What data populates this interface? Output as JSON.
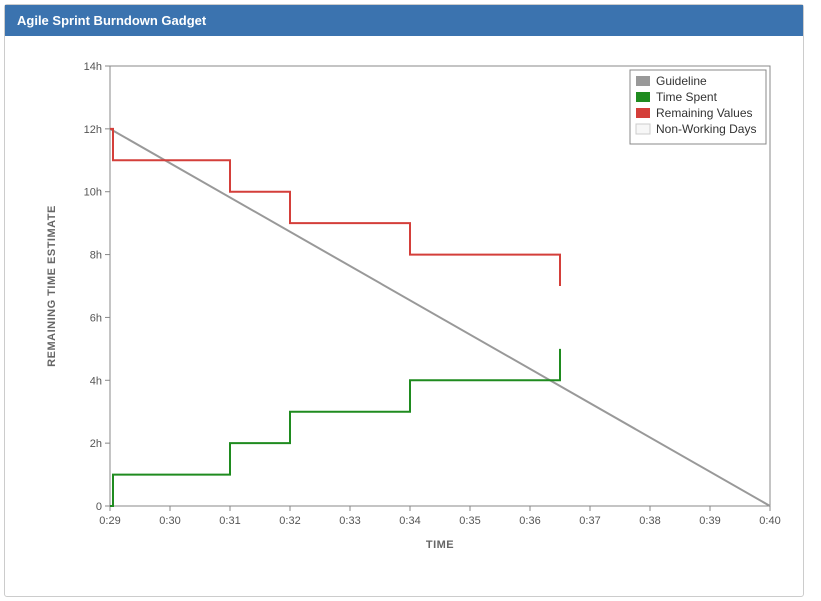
{
  "header": {
    "title": "Agile Sprint Burndown Gadget"
  },
  "chart_data": {
    "type": "line",
    "title": "",
    "xlabel": "TIME",
    "ylabel": "REMAINING TIME ESTIMATE",
    "xlim": [
      29,
      40
    ],
    "ylim": [
      0,
      14
    ],
    "x_tick_prefix": "0:",
    "y_tick_suffix": "h",
    "x_ticks": [
      29,
      30,
      31,
      32,
      33,
      34,
      35,
      36,
      37,
      38,
      39,
      40
    ],
    "y_ticks": [
      0,
      2,
      4,
      6,
      8,
      10,
      12,
      14
    ],
    "legend": {
      "position": "top-right",
      "items": [
        {
          "name": "Guideline",
          "color": "#999999",
          "type": "line"
        },
        {
          "name": "Time Spent",
          "color": "#1f8b1f",
          "type": "line"
        },
        {
          "name": "Remaining Values",
          "color": "#d43f3a",
          "type": "line"
        },
        {
          "name": "Non-Working Days",
          "color": "#f7f7f7",
          "type": "area",
          "border": "#cccccc"
        }
      ]
    },
    "series": [
      {
        "name": "Guideline",
        "color": "#999999",
        "mode": "line",
        "x": [
          29,
          40
        ],
        "y": [
          12,
          0
        ]
      },
      {
        "name": "Time Spent",
        "color": "#1f8b1f",
        "mode": "step",
        "x": [
          29.0,
          29.05,
          31.0,
          32.0,
          34.0,
          36.0,
          36.5
        ],
        "y": [
          0,
          1,
          2,
          3,
          4,
          4,
          5
        ],
        "end_x": 36.5
      },
      {
        "name": "Remaining Values",
        "color": "#d43f3a",
        "mode": "step",
        "x": [
          29.0,
          29.05,
          31.0,
          32.0,
          34.0,
          36.0,
          36.5
        ],
        "y": [
          12,
          11,
          10,
          9,
          8,
          8,
          7
        ],
        "end_x": 36.5
      }
    ]
  }
}
